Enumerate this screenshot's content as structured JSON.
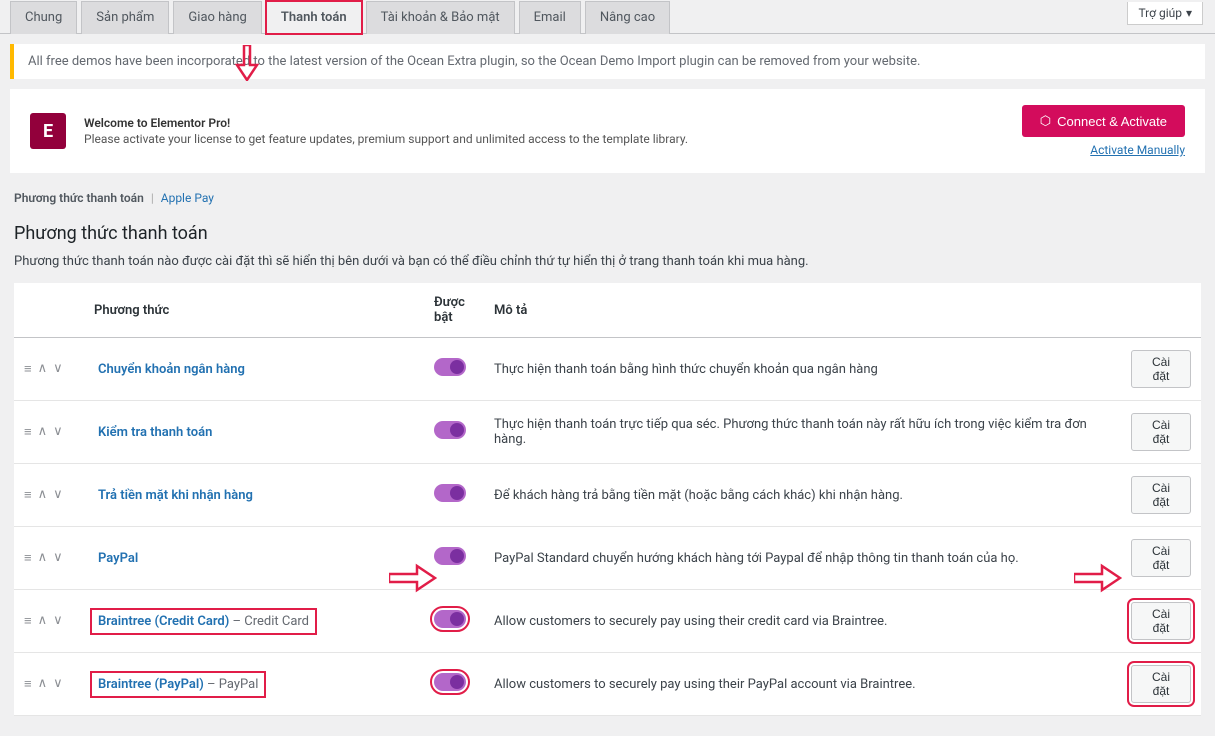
{
  "help_dropdown": "Trợ giúp",
  "tabs": [
    {
      "label": "Chung"
    },
    {
      "label": "Sản phẩm"
    },
    {
      "label": "Giao hàng"
    },
    {
      "label": "Thanh toán",
      "active": true,
      "highlight": true
    },
    {
      "label": "Tài khoản & Bảo mật"
    },
    {
      "label": "Email"
    },
    {
      "label": "Nâng cao"
    }
  ],
  "notice": "All free demos have been incorporated to the latest version of the Ocean Extra plugin, so the Ocean Demo Import plugin can be removed from your website.",
  "elementor": {
    "logo": "E",
    "title": "Welcome to Elementor Pro!",
    "desc": "Please activate your license to get feature updates, premium support and unlimited access to the template library.",
    "button": "Connect & Activate",
    "activate_link": "Activate Manually"
  },
  "breadcrumb": {
    "current": "Phương thức thanh toán",
    "other": "Apple Pay"
  },
  "section": {
    "heading": "Phương thức thanh toán",
    "description": "Phương thức thanh toán nào được cài đặt thì sẽ hiển thị bên dưới và bạn có thể điều chỉnh thứ tự hiển thị ở trang thanh toán khi mua hàng."
  },
  "columns": {
    "method": "Phương thức",
    "enabled": "Được bật",
    "desc": "Mô tả"
  },
  "settings_label": "Cài đặt",
  "methods": [
    {
      "name": "Chuyển khoản ngân hàng",
      "suffix": "",
      "enabled": true,
      "desc": "Thực hiện thanh toán bằng hình thức chuyển khoản qua ngân hàng"
    },
    {
      "name": "Kiểm tra thanh toán",
      "suffix": "",
      "enabled": true,
      "desc": "Thực hiện thanh toán trực tiếp qua séc. Phương thức thanh toán này rất hữu ích trong việc kiểm tra đơn hàng."
    },
    {
      "name": "Trả tiền mặt khi nhận hàng",
      "suffix": "",
      "enabled": true,
      "desc": "Để khách hàng trả bằng tiền mặt (hoặc bằng cách khác) khi nhận hàng."
    },
    {
      "name": "PayPal",
      "suffix": "",
      "enabled": true,
      "desc": "PayPal Standard chuyển hướng khách hàng tới Paypal để nhập thông tin thanh toán của họ."
    },
    {
      "name": "Braintree (Credit Card)",
      "suffix": " – Credit Card",
      "enabled": true,
      "desc": "Allow customers to securely pay using their credit card via Braintree.",
      "highlight": true
    },
    {
      "name": "Braintree (PayPal)",
      "suffix": " – PayPal",
      "enabled": true,
      "desc": "Allow customers to securely pay using their PayPal account via Braintree.",
      "highlight": true
    }
  ]
}
